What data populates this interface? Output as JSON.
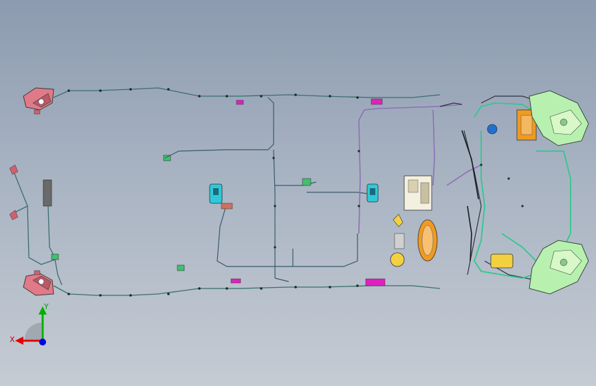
{
  "view": {
    "background_top": "#8c9bb0",
    "background_bottom": "#c5cbd3"
  },
  "triad": {
    "x_label": "X",
    "y_label": "Y",
    "x_color": "#e00000",
    "y_color": "#00b000",
    "z_color": "#0000e0"
  },
  "colors": {
    "harness_main": "#3a6e6e",
    "harness_purple": "#8f6fb8",
    "harness_green": "#30c890",
    "harness_dark": "#2a3340",
    "lamp_pink": "#e07a88",
    "headlamp_green": "#b8f0b0",
    "connector_yellow": "#f2d040",
    "connector_orange": "#f09a20",
    "connector_magenta": "#e020c0",
    "connector_cyan": "#30c8d8"
  },
  "components": [
    "tail-lamp-left",
    "tail-lamp-right",
    "headlamp-left",
    "headlamp-right",
    "fuse-box",
    "ecu-module",
    "battery-connector",
    "airbag-module",
    "door-connector-left",
    "door-connector-right"
  ]
}
